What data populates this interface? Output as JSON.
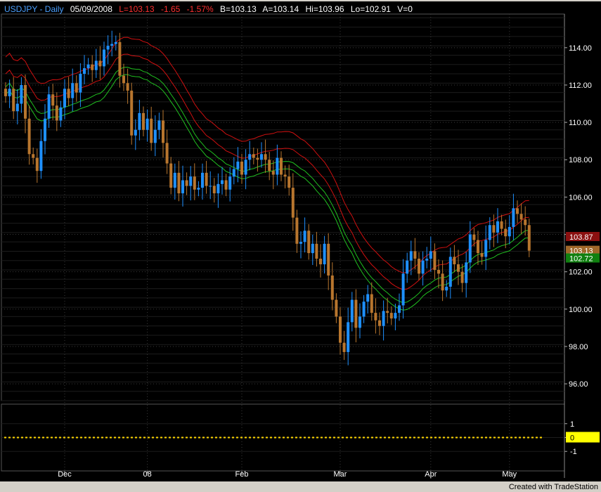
{
  "header": {
    "symbol": "USDJPY - Daily",
    "date": "05/09/2008",
    "last": "L=103.13",
    "change": "-1.65",
    "pct_change": "-1.57%",
    "bid": "B=103.13",
    "ask": "A=103.14",
    "high": "Hi=103.96",
    "low": "Lo=102.91",
    "volume": "V=0"
  },
  "footer": {
    "text": "Created with TradeStation"
  },
  "colors": {
    "background": "#000000",
    "up_candle": "#1e90ff",
    "down_candle": "#b8762e",
    "band_outer": "#d01010",
    "band_inner": "#20c020",
    "grid": "#3a3a3a",
    "label_text": "#ffffff",
    "header_blue": "#4aa0ff",
    "header_red": "#ff3030",
    "header_white": "#ffffff",
    "dotted_line": "#ffd700"
  },
  "chart_data": {
    "type": "candlestick",
    "title": "USDJPY - Daily",
    "y_axis": {
      "ticks": [
        "114.00",
        "112.00",
        "110.00",
        "108.00",
        "106.00",
        "104.00",
        "102.00",
        "100.00",
        "98.00",
        "96.00"
      ],
      "tick_values": [
        114,
        112,
        110,
        108,
        106,
        104,
        102,
        100,
        98,
        96
      ],
      "range": [
        95.1,
        115.8
      ]
    },
    "x_axis": {
      "labels": [
        "Dec",
        "08",
        "Feb",
        "Mar",
        "Apr",
        "May"
      ],
      "label_bar_index": [
        15,
        36,
        60,
        85,
        108,
        128
      ]
    },
    "price_markers": [
      {
        "label": "103.87",
        "value": 103.87,
        "color": "#8b1010"
      },
      {
        "label": "103.13",
        "value": 103.13,
        "color": "#a0682a"
      },
      {
        "label": "102.72",
        "value": 102.72,
        "color": "#108010"
      }
    ],
    "indicator": {
      "ticks": [
        "1",
        "0",
        "-1"
      ],
      "tick_values": [
        1,
        0,
        -1
      ],
      "range": [
        -1.9,
        1.9
      ],
      "zero_label": "0",
      "zero_line": 0
    },
    "closes": [
      111.4,
      111.8,
      110.6,
      111.0,
      112.0,
      110.2,
      108.3,
      108.1,
      107.4,
      109.0,
      110.2,
      111.5,
      110.9,
      110.1,
      110.8,
      111.8,
      111.3,
      112.1,
      111.6,
      112.6,
      112.9,
      113.1,
      112.8,
      113.3,
      113.0,
      113.9,
      114.1,
      114.2,
      114.3,
      112.5,
      112.1,
      111.7,
      109.3,
      109.6,
      110.5,
      109.6,
      110.2,
      108.9,
      109.6,
      110.1,
      108.9,
      107.8,
      106.5,
      107.3,
      106.2,
      106.9,
      106.6,
      107.1,
      106.4,
      106.5,
      107.3,
      106.6,
      106.6,
      106.2,
      106.7,
      106.9,
      106.4,
      107.1,
      107.5,
      107.9,
      107.2,
      108.0,
      108.3,
      108.1,
      108.0,
      108.3,
      108.0,
      107.4,
      107.2,
      108.1,
      107.2,
      107.1,
      106.5,
      104.9,
      103.5,
      103.6,
      104.2,
      103.0,
      103.5,
      102.7,
      102.4,
      103.5,
      101.8,
      100.5,
      99.6,
      98.2,
      97.7,
      99.3,
      100.5,
      99.0,
      99.6,
      100.4,
      100.8,
      99.8,
      99.4,
      99.1,
      99.9,
      99.8,
      99.5,
      99.8,
      100.2,
      101.9,
      102.6,
      103.1,
      102.7,
      101.9,
      102.6,
      102.7,
      103.1,
      102.1,
      101.9,
      101.0,
      101.2,
      102.8,
      102.4,
      102.0,
      101.4,
      102.5,
      104.0,
      103.7,
      103.0,
      102.8,
      103.7,
      104.5,
      104.1,
      104.7,
      104.3,
      103.9,
      104.4,
      105.4,
      105.1,
      104.8,
      104.5,
      103.13
    ],
    "bands": {
      "outer_upper_start": 114.6,
      "outer_lower_start": 113.7,
      "inner_upper_start": 113.0,
      "inner_lower_start": 112.6
    }
  }
}
